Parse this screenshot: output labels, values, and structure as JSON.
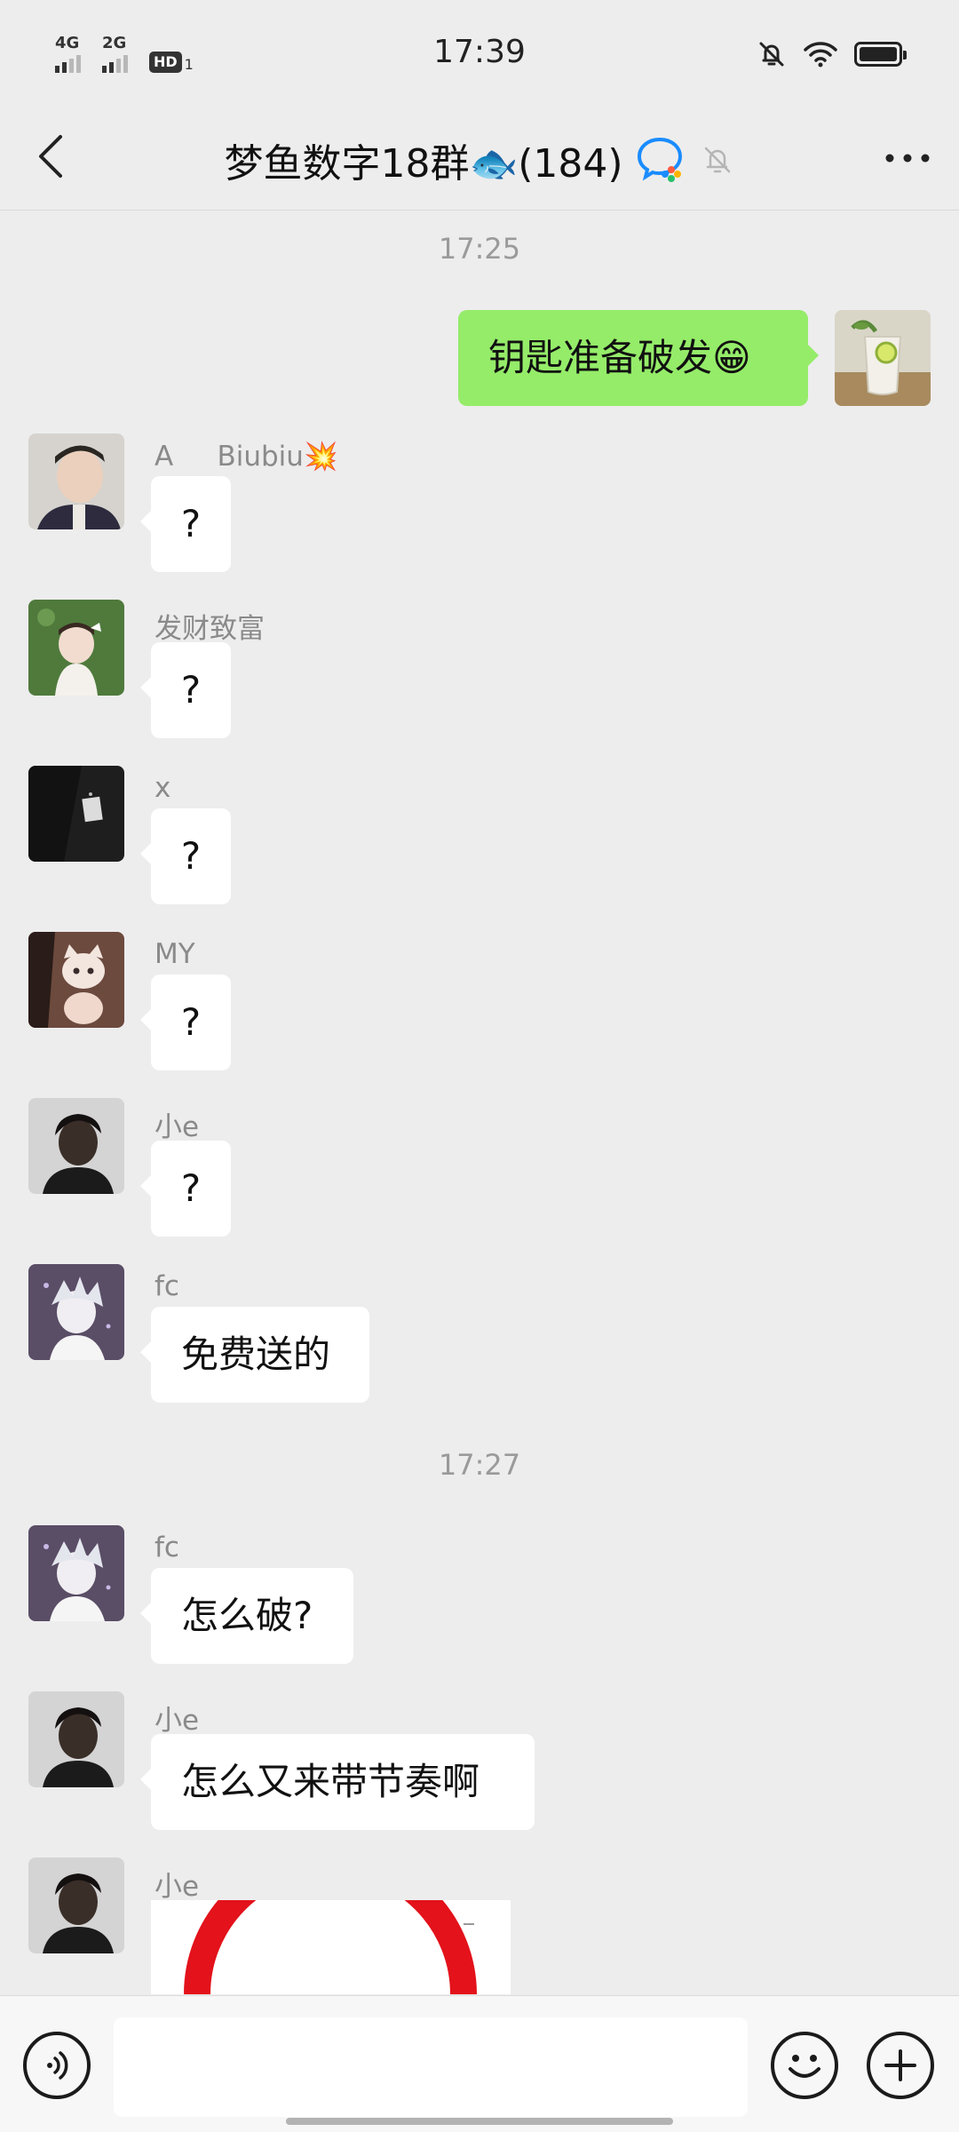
{
  "status_bar": {
    "time": "17:39",
    "signal_1": "4G",
    "signal_2": "2G",
    "hd_badge": "HD",
    "hd_sub": "1",
    "icons": [
      "bell-off-icon",
      "wifi-icon",
      "battery-icon"
    ]
  },
  "header": {
    "title": "梦鱼数字18群🐟(184)",
    "icons": [
      "back-arrow-icon",
      "wecom-group-icon",
      "mute-bell-icon",
      "more-dots-icon"
    ]
  },
  "chat": {
    "timestamps": [
      "17:25",
      "17:27"
    ],
    "outgoing": {
      "text": "钥匙准备破发😁"
    },
    "messages": [
      {
        "sender": "A     Biubiu💥",
        "text": "?"
      },
      {
        "sender": "发财致富",
        "text": "?"
      },
      {
        "sender": "x",
        "text": "?"
      },
      {
        "sender": "MY",
        "text": "?"
      },
      {
        "sender": "小e",
        "text": "?"
      },
      {
        "sender": "fc",
        "text": "免费送的"
      },
      {
        "sender": "fc",
        "text": "怎么破?"
      },
      {
        "sender": "小e",
        "text": "怎么又来带节奏啊"
      },
      {
        "sender": "小e",
        "text": ""
      }
    ]
  },
  "input_bar": {
    "icons": [
      "voice-icon",
      "emoji-icon",
      "plus-icon"
    ],
    "text_value": ""
  },
  "colors": {
    "background": "#ededed",
    "outgoing_bubble": "#95ec69",
    "incoming_bubble": "#ffffff",
    "accent_blue": "#1a8cff"
  }
}
